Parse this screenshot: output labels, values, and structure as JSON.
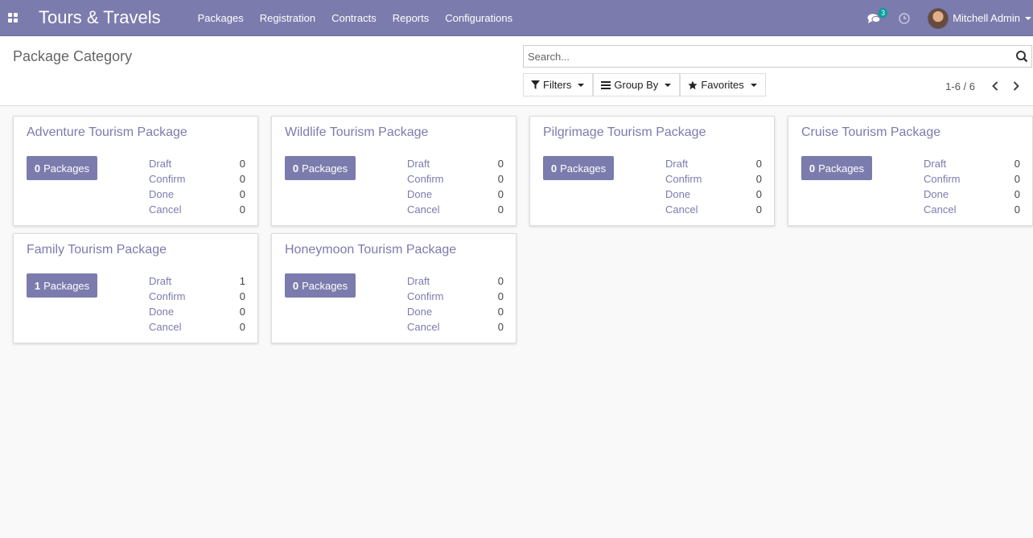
{
  "navbar": {
    "app_name": "Tours & Travels",
    "menu": [
      "Packages",
      "Registration",
      "Contracts",
      "Reports",
      "Configurations"
    ],
    "messages_count": "3",
    "user_name": "Mitchell Admin"
  },
  "control_panel": {
    "title": "Package Category",
    "search_placeholder": "Search...",
    "filters_label": "Filters",
    "group_by_label": "Group By",
    "favorites_label": "Favorites",
    "pager_value": "1-6 / 6"
  },
  "cards": [
    {
      "title": "Adventure Tourism Package",
      "count": "0",
      "count_label": "Packages",
      "stats": [
        [
          "Draft",
          "0"
        ],
        [
          "Confirm",
          "0"
        ],
        [
          "Done",
          "0"
        ],
        [
          "Cancel",
          "0"
        ]
      ]
    },
    {
      "title": "Wildlife Tourism Package",
      "count": "0",
      "count_label": "Packages",
      "stats": [
        [
          "Draft",
          "0"
        ],
        [
          "Confirm",
          "0"
        ],
        [
          "Done",
          "0"
        ],
        [
          "Cancel",
          "0"
        ]
      ]
    },
    {
      "title": "Pilgrimage Tourism Package",
      "count": "0",
      "count_label": "Packages",
      "stats": [
        [
          "Draft",
          "0"
        ],
        [
          "Confirm",
          "0"
        ],
        [
          "Done",
          "0"
        ],
        [
          "Cancel",
          "0"
        ]
      ]
    },
    {
      "title": "Cruise Tourism Package",
      "count": "0",
      "count_label": "Packages",
      "stats": [
        [
          "Draft",
          "0"
        ],
        [
          "Confirm",
          "0"
        ],
        [
          "Done",
          "0"
        ],
        [
          "Cancel",
          "0"
        ]
      ]
    },
    {
      "title": "Family Tourism Package",
      "count": "1",
      "count_label": "Packages",
      "stats": [
        [
          "Draft",
          "1"
        ],
        [
          "Confirm",
          "0"
        ],
        [
          "Done",
          "0"
        ],
        [
          "Cancel",
          "0"
        ]
      ]
    },
    {
      "title": "Honeymoon Tourism Package",
      "count": "0",
      "count_label": "Packages",
      "stats": [
        [
          "Draft",
          "0"
        ],
        [
          "Confirm",
          "0"
        ],
        [
          "Done",
          "0"
        ],
        [
          "Cancel",
          "0"
        ]
      ]
    }
  ],
  "colors": {
    "brand": "#7c7bad",
    "badge": "#00a09d"
  }
}
